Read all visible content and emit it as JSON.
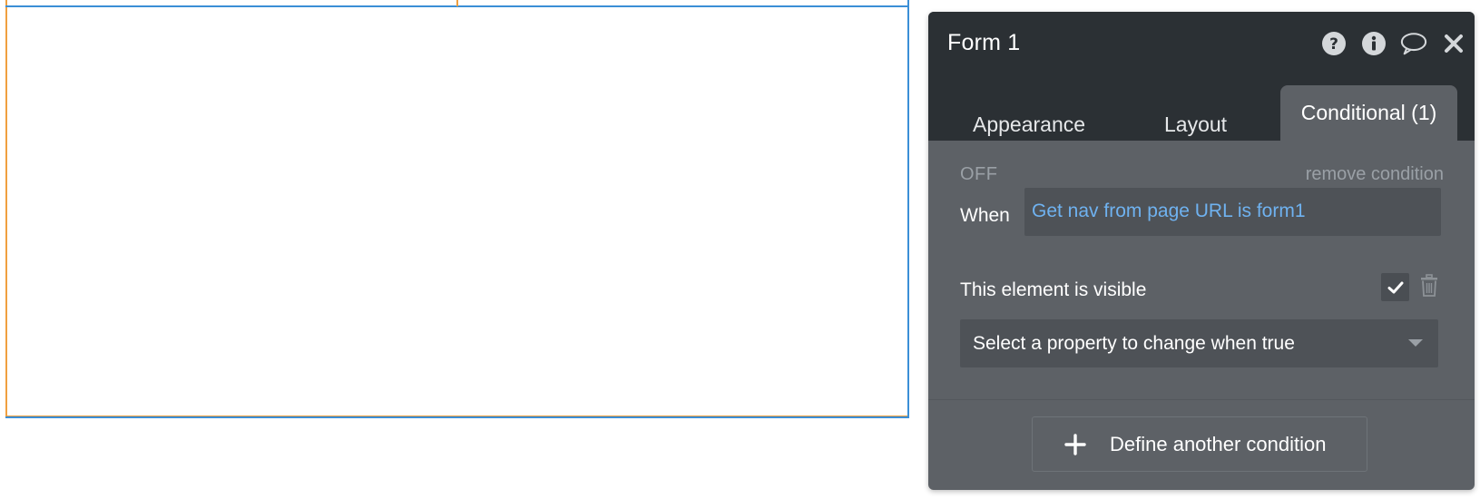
{
  "panel": {
    "title": "Form 1",
    "header_icons": [
      "help-icon",
      "info-icon",
      "comment-icon",
      "close-icon"
    ],
    "tabs": [
      {
        "label": "Appearance",
        "active": false
      },
      {
        "label": "Layout",
        "active": false
      },
      {
        "label": "Conditional (1)",
        "active": true
      }
    ]
  },
  "condition": {
    "status": "OFF",
    "remove_label": "remove condition",
    "when_label": "When",
    "expression": "Get nav from page URL is form1",
    "property_label": "This element is visible",
    "property_checked": true,
    "select_placeholder": "Select a property to change when true"
  },
  "actions": {
    "define_label": "Define another condition"
  },
  "colors": {
    "header_bg": "#2b3034",
    "panel_bg": "#5d6166",
    "field_bg": "#4e5257",
    "expression_text": "#6fb2f0",
    "canvas_border_orange": "#f0a040",
    "canvas_border_blue": "#3b8fd6"
  }
}
